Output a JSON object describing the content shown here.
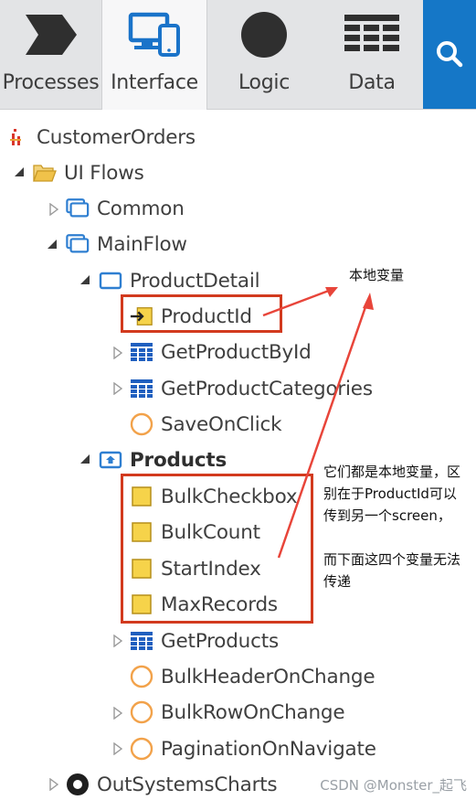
{
  "tabs": [
    {
      "label": "Processes",
      "icon": "processes-chevron-icon"
    },
    {
      "label": "Interface",
      "icon": "monitor-devices-icon"
    },
    {
      "label": "Logic",
      "icon": "logic-circle-icon"
    },
    {
      "label": "Data",
      "icon": "data-grid-icon"
    }
  ],
  "active_tab": "Interface",
  "search": {
    "icon": "search-icon"
  },
  "tree": {
    "module": "CustomerOrders",
    "ui_flows": "UI Flows",
    "common": "Common",
    "main_flow": "MainFlow",
    "product_detail": {
      "label": "ProductDetail",
      "items": [
        "ProductId",
        "GetProductById",
        "GetProductCategories",
        "SaveOnClick"
      ]
    },
    "products": {
      "label": "Products",
      "variables": [
        "BulkCheckbox",
        "BulkCount",
        "StartIndex",
        "MaxRecords"
      ],
      "items": [
        "GetProducts",
        "BulkHeaderOnChange",
        "BulkRowOnChange",
        "PaginationOnNavigate"
      ]
    },
    "charts": "OutSystemsCharts"
  },
  "annotations": {
    "note1": "本地变量",
    "note2": "它们都是本地变量，区别在于ProductId可以传到另一个screen，\n\n而下面这四个变量无法传递"
  },
  "watermark": "CSDN @Monster_起飞",
  "colors": {
    "accent_blue": "#1577c7",
    "highlight_red": "#d23a1e",
    "icon_blue": "#2f7fd1",
    "folder_yellow": "#f0c24a"
  }
}
